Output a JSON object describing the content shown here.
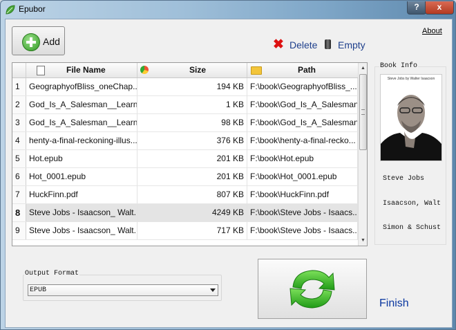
{
  "window": {
    "title": "Epubor",
    "help_label": "?",
    "close_label": "x"
  },
  "toolbar": {
    "add_label": "Add",
    "delete_label": "Delete",
    "empty_label": "Empty",
    "about_label": "About"
  },
  "table": {
    "columns": {
      "name": "File Name",
      "size": "Size",
      "path": "Path"
    },
    "rows": [
      {
        "num": "1",
        "name": "GeographyofBliss_oneChap...",
        "size": "194 KB",
        "path": "F:\\book\\GeographyofBliss_..."
      },
      {
        "num": "2",
        "name": "God_Is_A_Salesman__Learn_...",
        "size": "1 KB",
        "path": "F:\\book\\God_Is_A_Salesman_..."
      },
      {
        "num": "3",
        "name": "God_Is_A_Salesman__Learn_...",
        "size": "98 KB",
        "path": "F:\\book\\God_Is_A_Salesman_..."
      },
      {
        "num": "4",
        "name": "henty-a-final-reckoning-illus...",
        "size": "376 KB",
        "path": "F:\\book\\henty-a-final-recko..."
      },
      {
        "num": "5",
        "name": "Hot.epub",
        "size": "201 KB",
        "path": "F:\\book\\Hot.epub"
      },
      {
        "num": "6",
        "name": "Hot_0001.epub",
        "size": "201 KB",
        "path": "F:\\book\\Hot_0001.epub"
      },
      {
        "num": "7",
        "name": "HuckFinn.pdf",
        "size": "807 KB",
        "path": "F:\\book\\HuckFinn.pdf"
      },
      {
        "num": "8",
        "name": "Steve Jobs - Isaacson_ Walt...",
        "size": "4249 KB",
        "path": "F:\\book\\Steve Jobs - Isaacs..."
      },
      {
        "num": "9",
        "name": "Steve Jobs - Isaacson_ Walt...",
        "size": "717 KB",
        "path": "F:\\book\\Steve Jobs - Isaacs..."
      }
    ],
    "selected_row": "8"
  },
  "book_info": {
    "legend": "Book Info",
    "cover_caption": "Steve Jobs by Walter Isaacson",
    "title": "Steve Jobs",
    "author": "Isaacson, Walt",
    "publisher": "Simon & Schust"
  },
  "output": {
    "legend": "Output Format",
    "selected": "EPUB"
  },
  "status": {
    "finish_label": "Finish"
  },
  "colors": {
    "link_blue": "#1e3f8c",
    "finish_blue": "#0a37a0",
    "selected_row": "#e4e4e4"
  }
}
